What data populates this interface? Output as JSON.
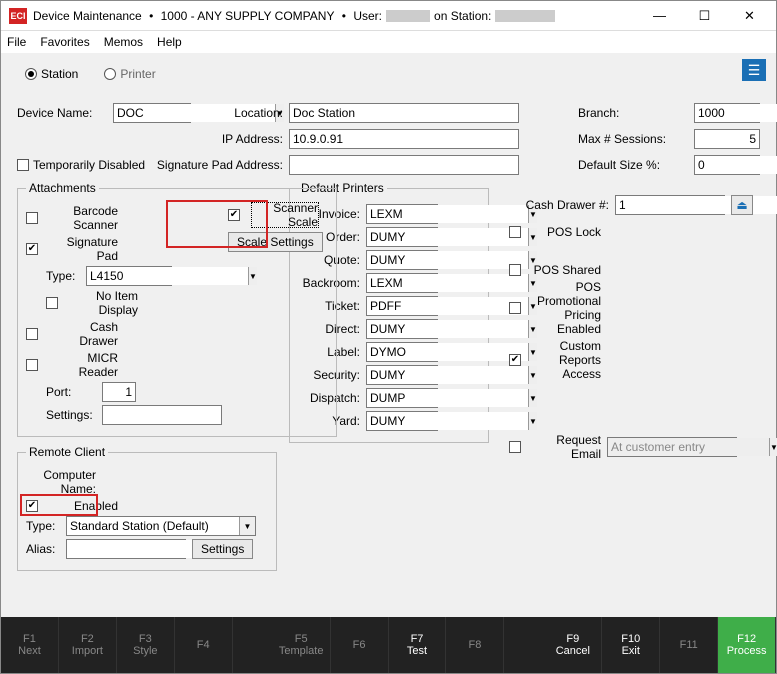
{
  "title": {
    "app": "Device Maintenance",
    "company": "1000 - ANY SUPPLY COMPANY",
    "user_prefix": "User:",
    "station_prefix": "on Station:"
  },
  "menu": {
    "file": "File",
    "favorites": "Favorites",
    "memos": "Memos",
    "help": "Help"
  },
  "mode": {
    "station": "Station",
    "printer": "Printer"
  },
  "device": {
    "name_lbl": "Device Name:",
    "name_val": "DOC",
    "location_lbl": "Location:",
    "location_val": "Doc Station",
    "ip_lbl": "IP Address:",
    "ip_val": "10.9.0.91",
    "temp_disabled_lbl": "Temporarily Disabled",
    "sig_addr_lbl": "Signature Pad Address:",
    "sig_addr_val": "",
    "branch_lbl": "Branch:",
    "branch_val": "1000",
    "max_sess_lbl": "Max # Sessions:",
    "max_sess_val": "5",
    "def_size_lbl": "Default Size %:",
    "def_size_val": "0"
  },
  "attachments": {
    "legend": "Attachments",
    "barcode": "Barcode Scanner",
    "scanner_scale": "Scanner Scale",
    "scale_settings_btn": "Scale Settings",
    "sig_pad": "Signature Pad",
    "type_lbl": "Type:",
    "type_val": "L4150",
    "no_item": "No Item Display",
    "cash_drawer": "Cash Drawer",
    "micr": "MICR Reader",
    "port_lbl": "Port:",
    "port_val": "1",
    "settings_lbl": "Settings:",
    "settings_val": ""
  },
  "remote": {
    "legend": "Remote Client",
    "comp_name_lbl": "Computer Name:",
    "enabled": "Enabled",
    "type_lbl": "Type:",
    "type_val": "Standard Station (Default)",
    "alias_lbl": "Alias:",
    "alias_val": "",
    "settings_btn": "Settings"
  },
  "printers": {
    "legend": "Default Printers",
    "rows": [
      {
        "lbl": "Invoice:",
        "val": "LEXM"
      },
      {
        "lbl": "Order:",
        "val": "DUMY"
      },
      {
        "lbl": "Quote:",
        "val": "DUMY"
      },
      {
        "lbl": "Backroom:",
        "val": "LEXM"
      },
      {
        "lbl": "Ticket:",
        "val": "PDFF"
      },
      {
        "lbl": "Direct:",
        "val": "DUMY"
      },
      {
        "lbl": "Label:",
        "val": "DYMO"
      },
      {
        "lbl": "Security:",
        "val": "DUMY"
      },
      {
        "lbl": "Dispatch:",
        "val": "DUMP"
      },
      {
        "lbl": "Yard:",
        "val": "DUMY"
      }
    ]
  },
  "right": {
    "cash_drawer_num_lbl": "Cash Drawer #:",
    "cash_drawer_num_val": "1",
    "pos_lock": "POS Lock",
    "pos_shared": "POS Shared",
    "pos_promo": "POS Promotional Pricing Enabled",
    "custom_reports": "Custom Reports Access",
    "request_email": "Request Email",
    "request_email_val": "At customer entry"
  },
  "fkeys": [
    {
      "k": "F1",
      "t": "Next",
      "a": false
    },
    {
      "k": "F2",
      "t": "Import",
      "a": false
    },
    {
      "k": "F3",
      "t": "Style",
      "a": false
    },
    {
      "k": "F4",
      "t": "",
      "a": false
    },
    {
      "k": "F5",
      "t": "Template",
      "a": false
    },
    {
      "k": "F6",
      "t": "",
      "a": false
    },
    {
      "k": "F7",
      "t": "Test",
      "a": true
    },
    {
      "k": "F8",
      "t": "",
      "a": false
    },
    {
      "k": "F9",
      "t": "Cancel",
      "a": true
    },
    {
      "k": "F10",
      "t": "Exit",
      "a": true
    },
    {
      "k": "F11",
      "t": "",
      "a": false
    },
    {
      "k": "F12",
      "t": "Process",
      "a": true,
      "g": true
    }
  ]
}
